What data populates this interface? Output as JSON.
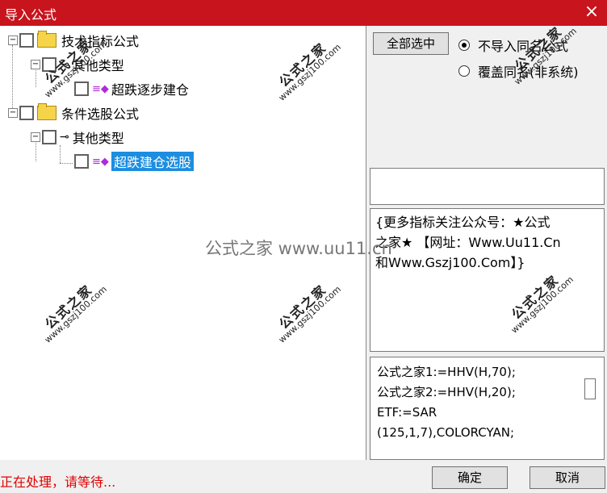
{
  "window": {
    "title": "导入公式",
    "close_icon": "close-icon"
  },
  "tree": {
    "root1_label": "技术指标公式",
    "root1_child_label": "其他类型",
    "root1_leaf_label": "超跌逐步建仓",
    "root2_label": "条件选股公式",
    "root2_child_label": "其他类型",
    "root2_leaf_label": "超跌建仓选股",
    "expanded_glyph": "−"
  },
  "right": {
    "select_all_label": "全部选中",
    "radio_no_import": "不导入同名公式",
    "radio_overwrite": "覆盖同名(非系统)",
    "selected_option": "radio_no_import"
  },
  "description": {
    "line1": "{更多指标关注公众号：★公式",
    "line2": "之家★ 【网址：Www.Uu11.Cn",
    "line3": "和Www.Gszj100.Com】}"
  },
  "code": {
    "line1": "公式之家1:=HHV(H,70);",
    "line2": "公式之家2:=HHV(H,20);",
    "line3": "ETF:=SAR",
    "line4": "(125,1,7),COLORCYAN;"
  },
  "footer": {
    "status": "正在处理，请等待...",
    "ok_label": "确定",
    "cancel_label": "取消"
  },
  "watermark": {
    "site": "www.gszj100.com",
    "brand": "公式之家",
    "center": "公式之家 www.uu11.cn"
  },
  "colors": {
    "title_bar": "#c8141c",
    "selection": "#1c8de0",
    "status_text": "#e00000"
  }
}
